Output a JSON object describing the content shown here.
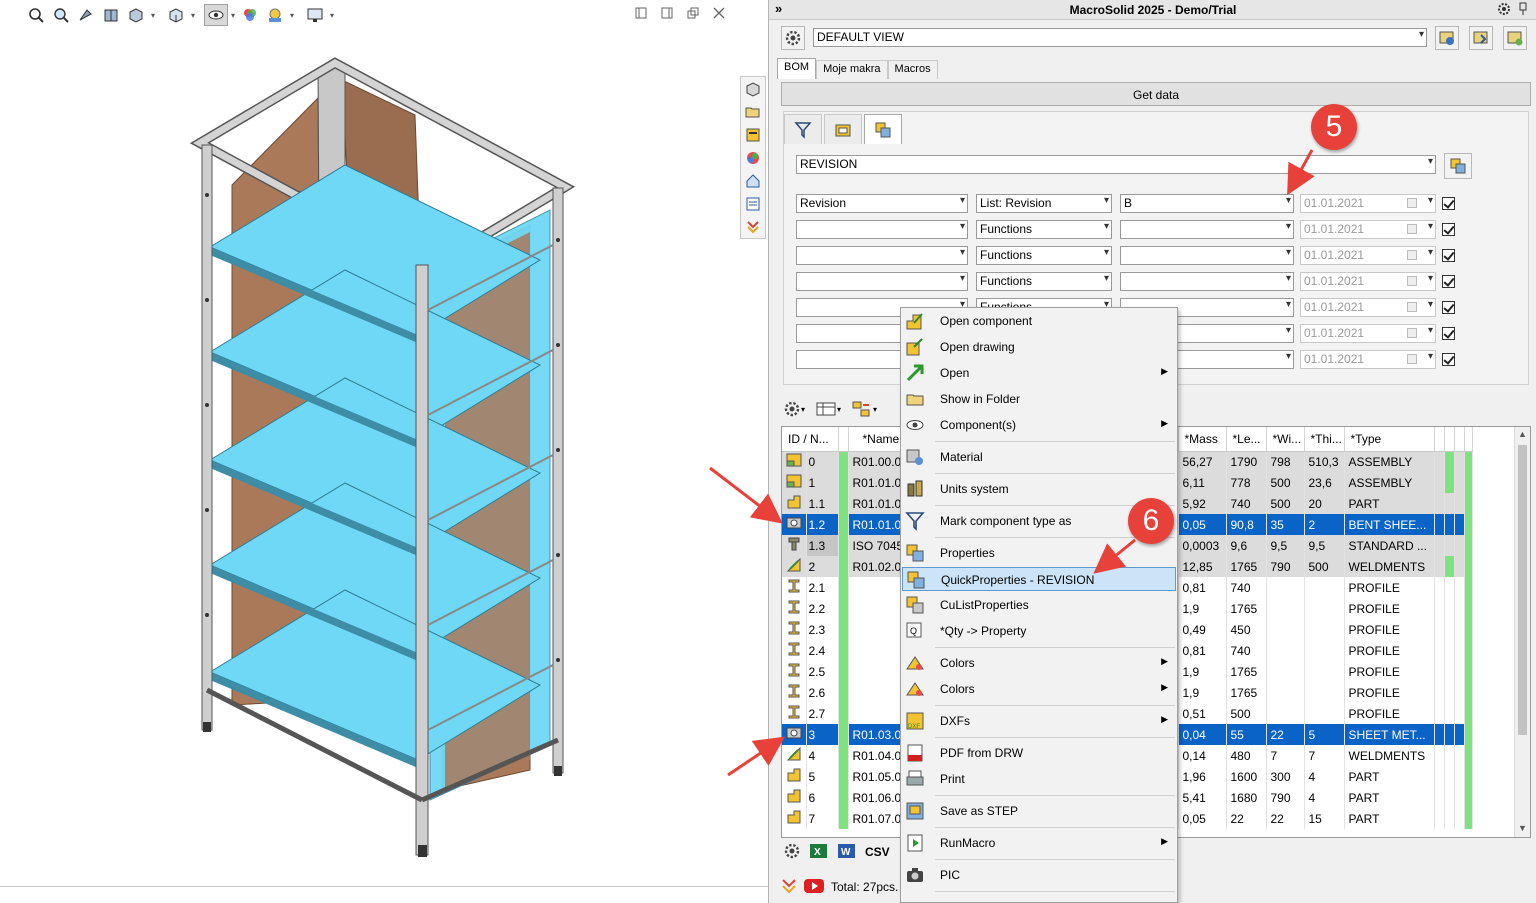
{
  "window": {
    "title": "MacroSolid 2025 - Demo/Trial"
  },
  "view_toolbar": {
    "icons": [
      "zoom-fit-icon",
      "zoom-area-icon",
      "previous-view-icon",
      "section-view-icon",
      "view-orientation-icon",
      "display-style-icon",
      "hide-show-icon",
      "edit-appearance-icon",
      "apply-scene-icon",
      "view-settings-icon"
    ]
  },
  "side_icons": [
    "parts-icon",
    "folder-open-icon",
    "properties-icon",
    "appearance-icon",
    "home-icon",
    "list-icon",
    "expand-icon"
  ],
  "pane": {
    "view_select": "DEFAULT VIEW",
    "tabs": [
      "BOM",
      "Moje makra",
      "Macros"
    ],
    "get_data": "Get data",
    "property_select": "REVISION",
    "filter_rows": [
      {
        "field": "Revision",
        "func": "List: Revision",
        "value": "B",
        "date": "01.01.2021"
      },
      {
        "field": "",
        "func": "Functions",
        "value": "",
        "date": "01.01.2021"
      },
      {
        "field": "",
        "func": "Functions",
        "value": "",
        "date": "01.01.2021"
      },
      {
        "field": "",
        "func": "Functions",
        "value": "",
        "date": "01.01.2021"
      },
      {
        "field": "",
        "func": "Functions",
        "value": "",
        "date": "01.01.2021"
      },
      {
        "field": "",
        "func": "",
        "value": "",
        "date": "01.01.2021"
      },
      {
        "field": "",
        "func": "",
        "value": "",
        "date": "01.01.2021"
      }
    ],
    "grid": {
      "headers": [
        "ID / N...",
        "*Name use",
        "*Mass",
        "*Le...",
        "*Wi...",
        "*Thi...",
        "*Type"
      ],
      "rows": [
        {
          "id": "0",
          "name": "R01.00.00",
          "mass": "56,27",
          "len": "1790",
          "wid": "798",
          "thi": "510,3",
          "type": "ASSEMBLY"
        },
        {
          "id": "1",
          "name": "R01.01.00",
          "mass": "6,11",
          "len": "778",
          "wid": "500",
          "thi": "23,6",
          "type": "ASSEMBLY"
        },
        {
          "id": "1.1",
          "name": "R01.01.01",
          "mass": "5,92",
          "len": "740",
          "wid": "500",
          "thi": "20",
          "type": "PART"
        },
        {
          "id": "1.2",
          "name": "R01.01.02",
          "mass": "0,05",
          "len": "90,8",
          "wid": "35",
          "thi": "2",
          "type": "BENT SHEE..."
        },
        {
          "id": "1.3",
          "name": "ISO 7045",
          "mass": "0,0003",
          "len": "9,6",
          "wid": "9,5",
          "thi": "9,5",
          "type": "STANDARD ..."
        },
        {
          "id": "2",
          "name": "R01.02.00",
          "mass": "12,85",
          "len": "1765",
          "wid": "790",
          "thi": "500",
          "type": "WELDMENTS"
        },
        {
          "id": "2.1",
          "name": "",
          "mass": "0,81",
          "len": "740",
          "wid": "",
          "thi": "",
          "type": "PROFILE"
        },
        {
          "id": "2.2",
          "name": "",
          "mass": "1,9",
          "len": "1765",
          "wid": "",
          "thi": "",
          "type": "PROFILE"
        },
        {
          "id": "2.3",
          "name": "",
          "mass": "0,49",
          "len": "450",
          "wid": "",
          "thi": "",
          "type": "PROFILE"
        },
        {
          "id": "2.4",
          "name": "",
          "mass": "0,81",
          "len": "740",
          "wid": "",
          "thi": "",
          "type": "PROFILE"
        },
        {
          "id": "2.5",
          "name": "",
          "mass": "1,9",
          "len": "1765",
          "wid": "",
          "thi": "",
          "type": "PROFILE"
        },
        {
          "id": "2.6",
          "name": "",
          "mass": "1,9",
          "len": "1765",
          "wid": "",
          "thi": "",
          "type": "PROFILE"
        },
        {
          "id": "2.7",
          "name": "",
          "mass": "0,51",
          "len": "500",
          "wid": "",
          "thi": "",
          "type": "PROFILE"
        },
        {
          "id": "3",
          "name": "R01.03.00",
          "mass": "0,04",
          "len": "55",
          "wid": "22",
          "thi": "5",
          "type": "SHEET MET..."
        },
        {
          "id": "4",
          "name": "R01.04.00",
          "mass": "0,14",
          "len": "480",
          "wid": "7",
          "thi": "7",
          "type": "WELDMENTS"
        },
        {
          "id": "5",
          "name": "R01.05.00",
          "mass": "1,96",
          "len": "1600",
          "wid": "300",
          "thi": "4",
          "type": "PART"
        },
        {
          "id": "6",
          "name": "R01.06.00",
          "mass": "5,41",
          "len": "1680",
          "wid": "790",
          "thi": "4",
          "type": "PART"
        },
        {
          "id": "7",
          "name": "R01.07.00",
          "mass": "0,05",
          "len": "22",
          "wid": "22",
          "thi": "15",
          "type": "PART"
        }
      ]
    },
    "export": {
      "csv": "CSV"
    },
    "status": {
      "total": "Total: 27pcs."
    }
  },
  "context_menu": {
    "items": [
      {
        "label": "Open component",
        "icon": "open-component-icon",
        "sub": false
      },
      {
        "label": "Open drawing",
        "icon": "open-drawing-icon",
        "sub": false
      },
      {
        "label": "Open",
        "icon": "open-arrow-icon",
        "sub": true
      },
      {
        "label": "Show in Folder",
        "icon": "folder-icon",
        "sub": false
      },
      {
        "label": "Component(s)",
        "icon": "eye-icon",
        "sub": true
      },
      {
        "label": "Material",
        "icon": "material-icon",
        "sub": false
      },
      {
        "label": "Units system",
        "icon": "units-icon",
        "sub": false
      },
      {
        "label": "Mark component type as",
        "icon": "filter-icon",
        "sub": false
      },
      {
        "label": "Properties",
        "icon": "properties-icon",
        "sub": false
      },
      {
        "label": "QuickProperties - REVISION",
        "icon": "quick-properties-icon",
        "sub": false
      },
      {
        "label": "CuListProperties",
        "icon": "cutlist-icon",
        "sub": false
      },
      {
        "label": "*Qty -> Property",
        "icon": "qty-icon",
        "sub": false
      },
      {
        "label": "Colors",
        "icon": "colors-icon",
        "sub": true
      },
      {
        "label": "Colors",
        "icon": "colors-icon",
        "sub": true
      },
      {
        "label": "DXFs",
        "icon": "dxf-icon",
        "sub": true
      },
      {
        "label": "PDF from DRW",
        "icon": "pdf-icon",
        "sub": false
      },
      {
        "label": "Print",
        "icon": "print-icon",
        "sub": false
      },
      {
        "label": "Save as STEP",
        "icon": "step-icon",
        "sub": false
      },
      {
        "label": "RunMacro",
        "icon": "macro-icon",
        "sub": true
      },
      {
        "label": "PIC",
        "icon": "camera-icon",
        "sub": false
      }
    ]
  },
  "annotations": {
    "step5": "5",
    "step6": "6"
  },
  "colors": {
    "accent": "#0a64c8",
    "badge": "#e8413a",
    "green": "#7ee27e",
    "shelf": "#6fd8f6",
    "wood": "#a9795a"
  }
}
